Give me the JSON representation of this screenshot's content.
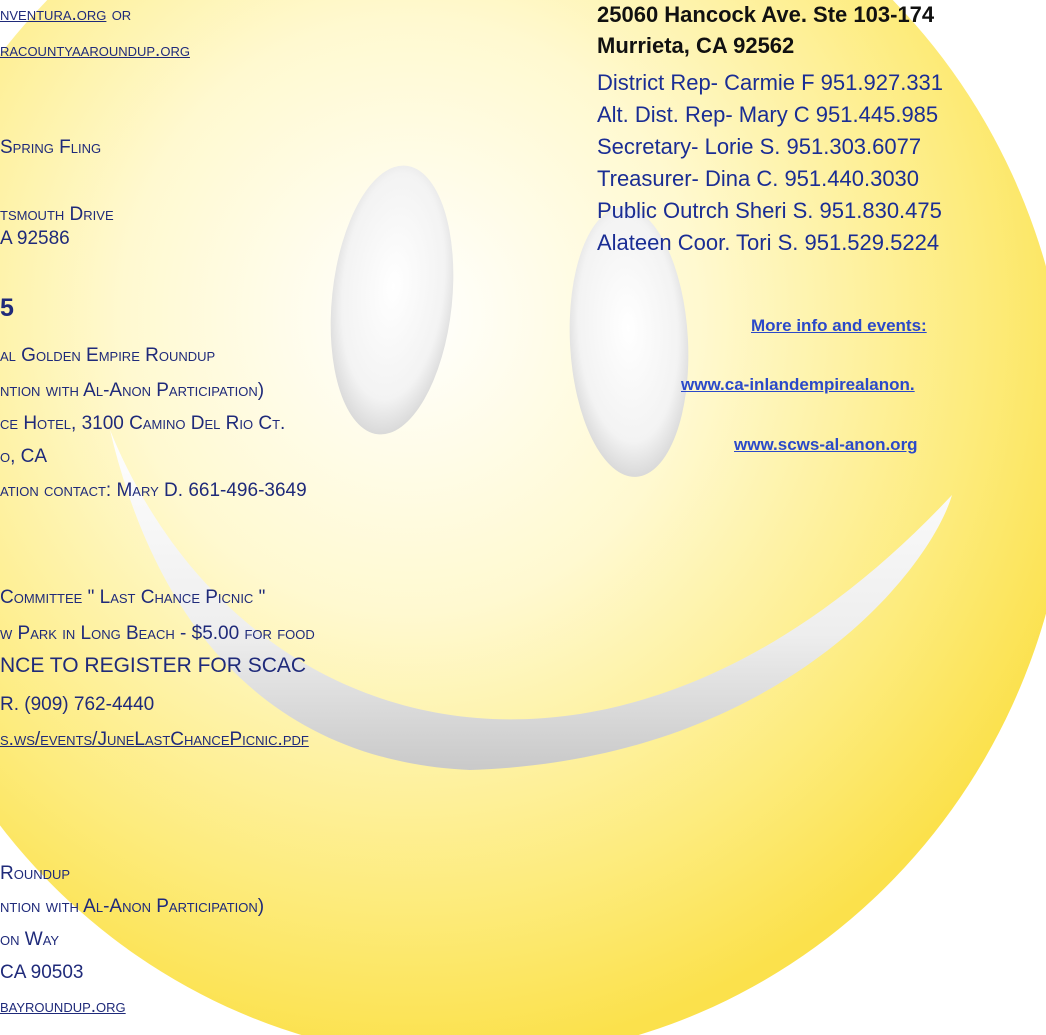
{
  "left": {
    "top_links": {
      "link1": "nventura.org",
      "or": "or",
      "link2": "racountyaaroundup.org"
    },
    "spring": {
      "title": "Spring Fling",
      "addr1": "tsmouth Drive",
      "addr2": "A 92586"
    },
    "section_header": "5",
    "golden": {
      "title": "al Golden Empire Roundup",
      "subtitle": "ntion with Al-Anon Participation)",
      "hotel": "ce Hotel, 3100 Camino Del Rio Ct.",
      "city": "o, CA",
      "contact": "ation contact: Mary D. 661-496-3649"
    },
    "picnic": {
      "title": "Committee \" Last Chance Picnic \"",
      "park": "w Park in Long Beach - $5.00 for food",
      "register": "nce to register for SCAC",
      "phone": "R. (909) 762-4440",
      "url": "s.ws/events/JuneLastChancePicnic.pdf"
    },
    "roundup": {
      "title": "Roundup",
      "subtitle": "ntion with Al-Anon Participation)",
      "addr1": "on Way",
      "addr2": "CA 90503",
      "url": "bayroundup.org"
    }
  },
  "right": {
    "address1": "25060 Hancock Ave. Ste 103-174",
    "address2": "Murrieta, CA 92562",
    "contacts": [
      "District Rep- Carmie F 951.927.331",
      "Alt. Dist. Rep- Mary C 951.445.985",
      "Secretary- Lorie S. 951.303.6077",
      "Treasurer- Dina C. 951.440.3030",
      "Public Outrch Sheri S. 951.830.475",
      "Alateen Coor. Tori S. 951.529.5224"
    ],
    "more_info": "More info and events:",
    "link1": "www.ca-inlandempirealanon.",
    "link2": "www.scws-al-anon.org"
  },
  "colors": {
    "smiley_center": "#fffde6",
    "smiley_edge": "#fce55a",
    "text_left": "#1f2a7a",
    "text_right": "#1a2d94",
    "link_right": "#2b49c9"
  }
}
